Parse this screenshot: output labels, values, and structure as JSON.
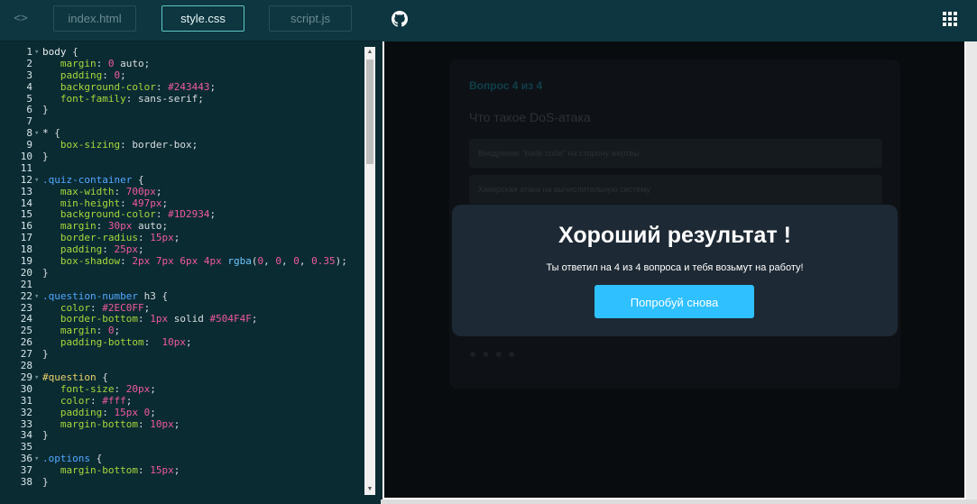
{
  "editor": {
    "tabs": [
      "index.html",
      "style.css",
      "script.js"
    ],
    "active_tab": "style.css",
    "lines": [
      [
        [
          "t-sel",
          "body "
        ],
        [
          "t-p",
          "{"
        ]
      ],
      [
        [
          "t-p",
          "   "
        ],
        [
          "t-prop",
          "margin"
        ],
        [
          "t-p",
          ": "
        ],
        [
          "t-num",
          "0"
        ],
        [
          "t-p",
          " auto;"
        ]
      ],
      [
        [
          "t-p",
          "   "
        ],
        [
          "t-prop",
          "padding"
        ],
        [
          "t-p",
          ": "
        ],
        [
          "t-num",
          "0"
        ],
        [
          "t-p",
          ";"
        ]
      ],
      [
        [
          "t-p",
          "   "
        ],
        [
          "t-prop",
          "background-color"
        ],
        [
          "t-p",
          ": "
        ],
        [
          "t-num",
          "#243443"
        ],
        [
          "t-p",
          ";"
        ]
      ],
      [
        [
          "t-p",
          "   "
        ],
        [
          "t-prop",
          "font-family"
        ],
        [
          "t-p",
          ": sans-serif;"
        ]
      ],
      [
        [
          "t-p",
          "}"
        ]
      ],
      [],
      [
        [
          "t-sel",
          "* "
        ],
        [
          "t-p",
          "{"
        ]
      ],
      [
        [
          "t-p",
          "   "
        ],
        [
          "t-prop",
          "box-sizing"
        ],
        [
          "t-p",
          ": border-box;"
        ]
      ],
      [
        [
          "t-p",
          "}"
        ]
      ],
      [],
      [
        [
          "t-cls",
          ".quiz-container"
        ],
        [
          "t-p",
          " {"
        ]
      ],
      [
        [
          "t-p",
          "   "
        ],
        [
          "t-prop",
          "max-width"
        ],
        [
          "t-p",
          ": "
        ],
        [
          "t-num",
          "700px"
        ],
        [
          "t-p",
          ";"
        ]
      ],
      [
        [
          "t-p",
          "   "
        ],
        [
          "t-prop",
          "min-height"
        ],
        [
          "t-p",
          ": "
        ],
        [
          "t-num",
          "497px"
        ],
        [
          "t-p",
          ";"
        ]
      ],
      [
        [
          "t-p",
          "   "
        ],
        [
          "t-prop",
          "background-color"
        ],
        [
          "t-p",
          ": "
        ],
        [
          "t-num",
          "#1D2934"
        ],
        [
          "t-p",
          ";"
        ]
      ],
      [
        [
          "t-p",
          "   "
        ],
        [
          "t-prop",
          "margin"
        ],
        [
          "t-p",
          ": "
        ],
        [
          "t-num",
          "30px"
        ],
        [
          "t-p",
          " auto;"
        ]
      ],
      [
        [
          "t-p",
          "   "
        ],
        [
          "t-prop",
          "border-radius"
        ],
        [
          "t-p",
          ": "
        ],
        [
          "t-num",
          "15px"
        ],
        [
          "t-p",
          ";"
        ]
      ],
      [
        [
          "t-p",
          "   "
        ],
        [
          "t-prop",
          "padding"
        ],
        [
          "t-p",
          ": "
        ],
        [
          "t-num",
          "25px"
        ],
        [
          "t-p",
          ";"
        ]
      ],
      [
        [
          "t-p",
          "   "
        ],
        [
          "t-prop",
          "box-shadow"
        ],
        [
          "t-p",
          ": "
        ],
        [
          "t-num",
          "2px 7px 6px 4px "
        ],
        [
          "t-fn",
          "rgba"
        ],
        [
          "t-p",
          "("
        ],
        [
          "t-num",
          "0"
        ],
        [
          "t-p",
          ", "
        ],
        [
          "t-num",
          "0"
        ],
        [
          "t-p",
          ", "
        ],
        [
          "t-num",
          "0"
        ],
        [
          "t-p",
          ", "
        ],
        [
          "t-num",
          "0.35"
        ],
        [
          "t-p",
          ");"
        ]
      ],
      [
        [
          "t-p",
          "}"
        ]
      ],
      [],
      [
        [
          "t-cls",
          ".question-number"
        ],
        [
          "t-p",
          " h3 {"
        ]
      ],
      [
        [
          "t-p",
          "   "
        ],
        [
          "t-prop",
          "color"
        ],
        [
          "t-p",
          ": "
        ],
        [
          "t-num",
          "#2EC0FF"
        ],
        [
          "t-p",
          ";"
        ]
      ],
      [
        [
          "t-p",
          "   "
        ],
        [
          "t-prop",
          "border-bottom"
        ],
        [
          "t-p",
          ": "
        ],
        [
          "t-num",
          "1px"
        ],
        [
          "t-p",
          " solid "
        ],
        [
          "t-num",
          "#504F4F"
        ],
        [
          "t-p",
          ";"
        ]
      ],
      [
        [
          "t-p",
          "   "
        ],
        [
          "t-prop",
          "margin"
        ],
        [
          "t-p",
          ": "
        ],
        [
          "t-num",
          "0"
        ],
        [
          "t-p",
          ";"
        ]
      ],
      [
        [
          "t-p",
          "   "
        ],
        [
          "t-prop",
          "padding-bottom"
        ],
        [
          "t-p",
          ":  "
        ],
        [
          "t-num",
          "10px"
        ],
        [
          "t-p",
          ";"
        ]
      ],
      [
        [
          "t-p",
          "}"
        ]
      ],
      [],
      [
        [
          "t-id",
          "#question"
        ],
        [
          "t-p",
          " {"
        ]
      ],
      [
        [
          "t-p",
          "   "
        ],
        [
          "t-prop",
          "font-size"
        ],
        [
          "t-p",
          ": "
        ],
        [
          "t-num",
          "20px"
        ],
        [
          "t-p",
          ";"
        ]
      ],
      [
        [
          "t-p",
          "   "
        ],
        [
          "t-prop",
          "color"
        ],
        [
          "t-p",
          ": "
        ],
        [
          "t-num",
          "#fff"
        ],
        [
          "t-p",
          ";"
        ]
      ],
      [
        [
          "t-p",
          "   "
        ],
        [
          "t-prop",
          "padding"
        ],
        [
          "t-p",
          ": "
        ],
        [
          "t-num",
          "15px 0"
        ],
        [
          "t-p",
          ";"
        ]
      ],
      [
        [
          "t-p",
          "   "
        ],
        [
          "t-prop",
          "margin-bottom"
        ],
        [
          "t-p",
          ": "
        ],
        [
          "t-num",
          "10px"
        ],
        [
          "t-p",
          ";"
        ]
      ],
      [
        [
          "t-p",
          "}"
        ]
      ],
      [],
      [
        [
          "t-cls",
          ".options"
        ],
        [
          "t-p",
          " {"
        ]
      ],
      [
        [
          "t-p",
          "   "
        ],
        [
          "t-prop",
          "margin-bottom"
        ],
        [
          "t-p",
          ": "
        ],
        [
          "t-num",
          "15px"
        ],
        [
          "t-p",
          ";"
        ]
      ],
      [
        [
          "t-p",
          "}"
        ]
      ]
    ],
    "folds": [
      1,
      8,
      12,
      22,
      29,
      36
    ]
  },
  "preview": {
    "quiz": {
      "question_number": "Вопрос 4 из 4",
      "question": "Что такое DoS-атака",
      "options": [
        "Внедрение \"bade code\" на сторону жертвы",
        "Хакерская атака на вычислительную систему"
      ],
      "dots": "● ● ● ●"
    },
    "modal": {
      "title": "Хороший результат !",
      "text": "Ты ответил на 4 из 4 вопроса и тебя возьмут на работу!",
      "button": "Попробуй снова"
    }
  },
  "icons": {
    "code_toggle": "code-brackets-icon",
    "github": "github-icon",
    "apps": "grid-icon"
  },
  "colors": {
    "accent": "#2ec0ff",
    "modal_bg": "#1d2934",
    "editor_bg": "#0b2b33"
  }
}
